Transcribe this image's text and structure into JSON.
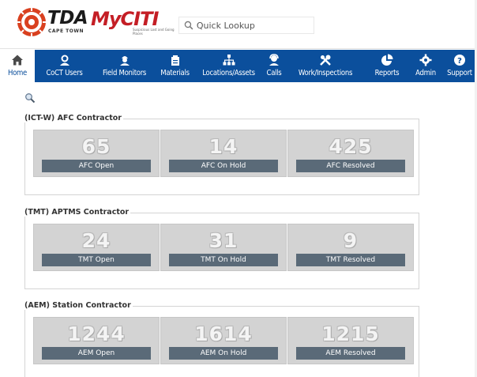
{
  "header": {
    "logo_tda": "TDA",
    "logo_city": "CAPE TOWN",
    "logo_myciti": "MyCITI",
    "logo_tagline": "Suspicious Lost and Going Places",
    "search_placeholder": "Quick Lookup"
  },
  "nav": {
    "items": [
      {
        "label": "Home",
        "icon": "home-icon"
      },
      {
        "label": "CoCT Users",
        "icon": "users-icon"
      },
      {
        "label": "Field Monitors",
        "icon": "field-monitor-icon"
      },
      {
        "label": "Materials",
        "icon": "materials-icon"
      },
      {
        "label": "Locations/Assets",
        "icon": "sitemap-icon"
      },
      {
        "label": "Calls",
        "icon": "support-agent-icon"
      },
      {
        "label": "Work/Inspections",
        "icon": "tools-icon"
      },
      {
        "label": "Reports",
        "icon": "pie-chart-icon"
      },
      {
        "label": "Admin",
        "icon": "gear-icon"
      },
      {
        "label": "Support",
        "icon": "help-icon"
      }
    ],
    "active": "Home",
    "bg_color": "#0b4f9c"
  },
  "groups": [
    {
      "legend": "(ICT-W) AFC Contractor",
      "tiles": [
        {
          "value": "65",
          "label": "AFC Open"
        },
        {
          "value": "14",
          "label": "AFC On Hold"
        },
        {
          "value": "425",
          "label": "AFC Resolved"
        }
      ]
    },
    {
      "legend": "(TMT) APTMS Contractor",
      "tiles": [
        {
          "value": "24",
          "label": "TMT Open"
        },
        {
          "value": "31",
          "label": "TMT On Hold"
        },
        {
          "value": "9",
          "label": "TMT Resolved"
        }
      ]
    },
    {
      "legend": "(AEM) Station Contractor",
      "tiles": [
        {
          "value": "1244",
          "label": "AEM Open"
        },
        {
          "value": "1614",
          "label": "AEM On Hold"
        },
        {
          "value": "1215",
          "label": "AEM Resolved"
        }
      ]
    }
  ]
}
